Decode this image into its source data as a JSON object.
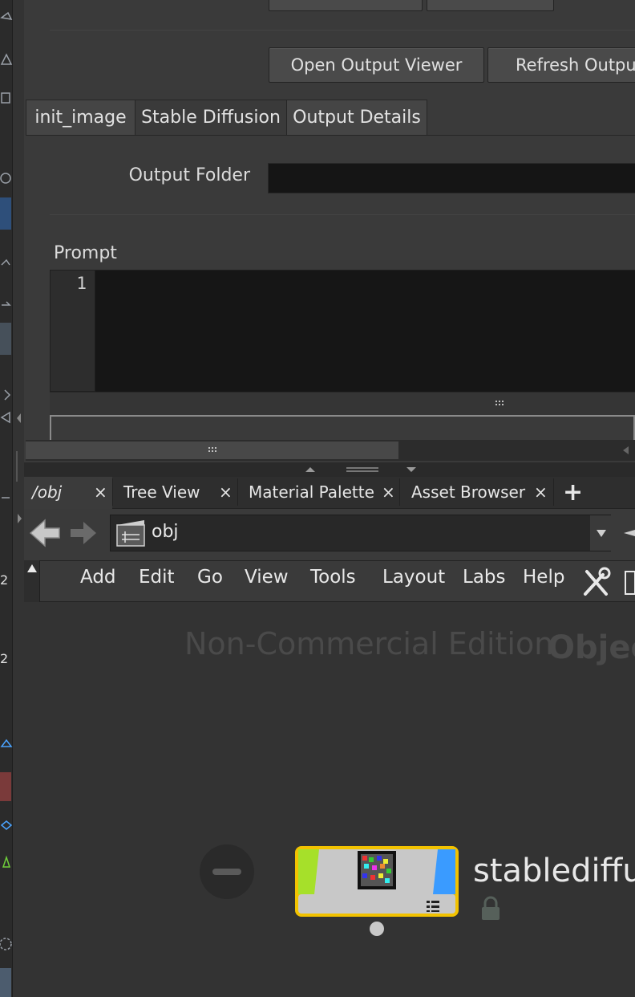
{
  "header_buttons": {
    "open_output_viewer": "Open Output Viewer",
    "refresh_output": "Refresh Output"
  },
  "param_tabs": [
    {
      "label": "init_image",
      "active": false
    },
    {
      "label": "Stable Diffusion",
      "active": true
    },
    {
      "label": "Output Details",
      "active": false
    }
  ],
  "output_folder": {
    "label": "Output Folder",
    "value": ""
  },
  "prompt": {
    "label": "Prompt",
    "line_number": "1",
    "value": ""
  },
  "pane_tabs": [
    {
      "label": "/obj",
      "close": "×"
    },
    {
      "label": "Tree View",
      "close": "×"
    },
    {
      "label": "Material Palette",
      "close": "×"
    },
    {
      "label": "Asset Browser",
      "close": "×"
    }
  ],
  "add_tab_label": "+",
  "path_bar": {
    "value": "obj"
  },
  "menu": [
    "Add",
    "Edit",
    "Go",
    "View",
    "Tools",
    "Layout",
    "Labs",
    "Help"
  ],
  "watermark": {
    "edition": "Non-Commercial Edition",
    "context": "Objec"
  },
  "node": {
    "name": "stablediffu"
  },
  "colors": {
    "node_left_flag": "#a6e02a",
    "node_right_flag": "#3a9bff",
    "node_outline": "#f2c200",
    "background": "#333333"
  },
  "icons": [
    "back-arrow-icon",
    "forward-arrow-icon",
    "clapboard-icon",
    "dropdown-icon",
    "tools-icon",
    "lock-icon",
    "bypass-icon",
    "close-icon",
    "plus-icon"
  ]
}
